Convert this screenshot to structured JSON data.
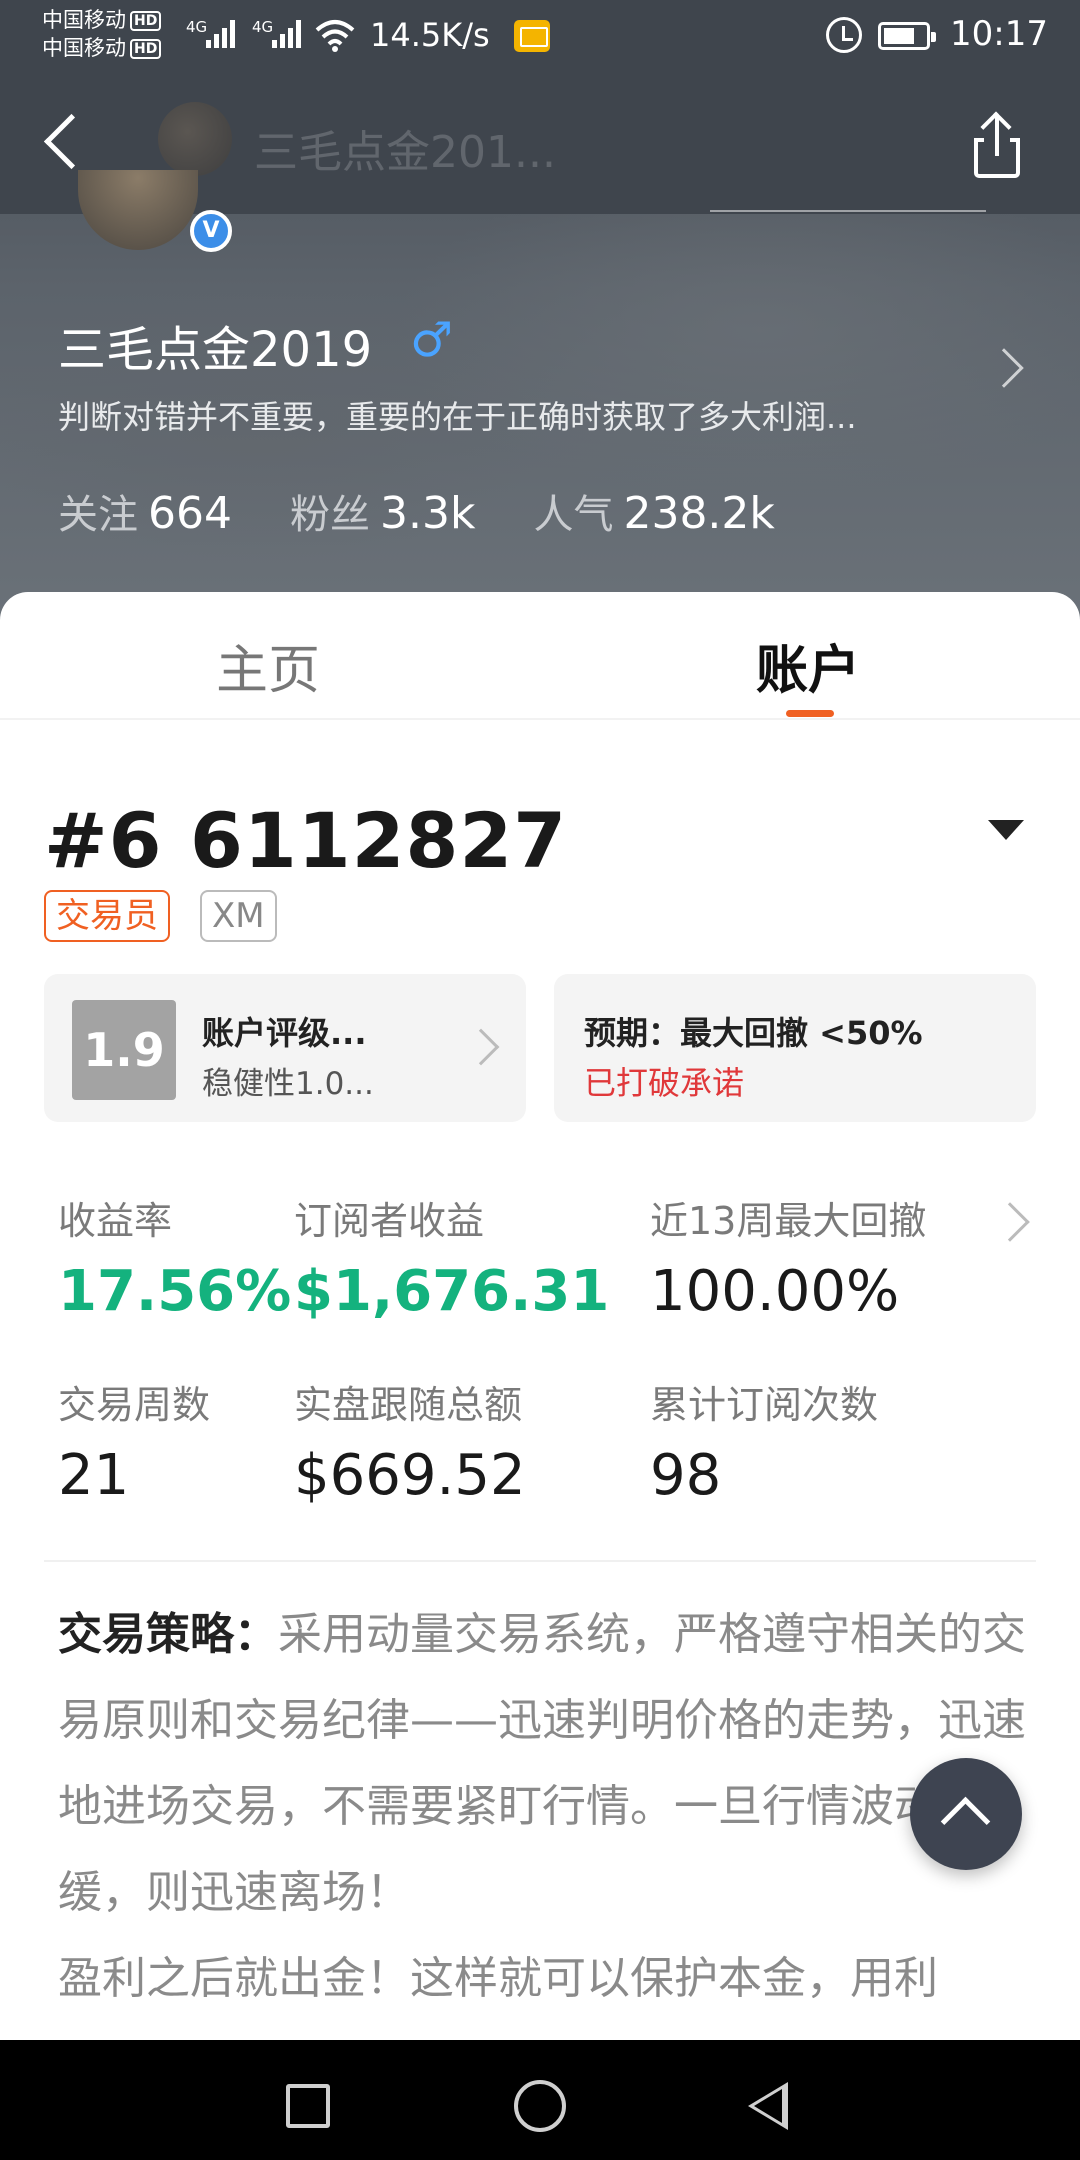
{
  "status_bar": {
    "carrier_1": "中国移动",
    "carrier_2": "中国移动",
    "hd": "HD",
    "network": "4G",
    "speed": "14.5K/s",
    "time": "10:17"
  },
  "nav": {
    "title": "三毛点金201..."
  },
  "profile": {
    "name": "三毛点金2019",
    "gender_icon": "♂",
    "verified": "V",
    "bio": "判断对错并不重要，重要的在于正确时获取了多大利润...",
    "following_label": "关注",
    "following": "664",
    "fans_label": "粉丝",
    "fans": "3.3k",
    "popularity_label": "人气",
    "popularity": "238.2k"
  },
  "tabs": [
    {
      "label": "主页"
    },
    {
      "label": "账户"
    }
  ],
  "account": {
    "number": "#6 6112827",
    "tags": [
      "交易员",
      "XM"
    ],
    "rating_score": "1.9",
    "rating_title": "账户评级...",
    "rating_sub": "稳健性1.0...",
    "expect_title": "预期：最大回撤 <50%",
    "expect_status": "已打破承诺"
  },
  "metrics": [
    {
      "label": "收益率",
      "value": "17.56%"
    },
    {
      "label": "订阅者收益",
      "value": "$1,676.31"
    },
    {
      "label": "近13周最大回撤",
      "value": "100.00%"
    },
    {
      "label": "交易周数",
      "value": "21"
    },
    {
      "label": "实盘跟随总额",
      "value": "$669.52"
    },
    {
      "label": "累计订阅次数",
      "value": "98"
    }
  ],
  "strategy": {
    "label": "交易策略：",
    "text": "采用动量交易系统，严格遵守相关的交易原则和交易纪律——迅速判明价格的走势，迅速地进场交易，不需要紧盯行情。一旦行情波动趋缓，则迅速离场！",
    "text_2": "盈利之后就出金！这样就可以保护本金，用利"
  },
  "colors": {
    "accent_orange": "#f06022",
    "positive_green": "#14b27e",
    "warning_red": "#e0383a",
    "header_dark": "#3f454d"
  }
}
